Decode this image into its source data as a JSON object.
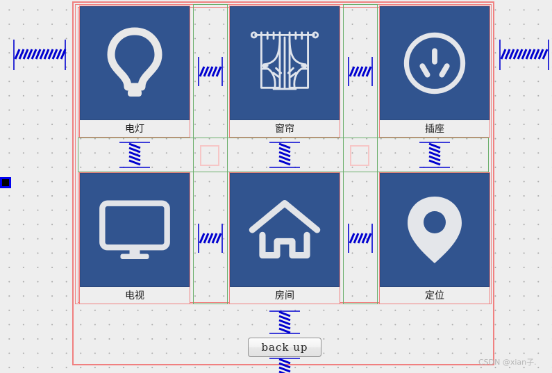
{
  "editor": {
    "name": "qt-designer-form-canvas",
    "background_color": "#eeeeee",
    "grid_dot_color": "#a8a8a8",
    "layout_border_color": "#f08080",
    "grid_layout_border_color": "#6aae6a",
    "empty_cell_color": "#f6c6c6",
    "spring_color": "#0000d0",
    "tile_color": "#31548f",
    "icon_color": "#e8e8e8"
  },
  "tiles": [
    {
      "id": "light",
      "label": "电灯",
      "icon": "lightbulb-icon"
    },
    {
      "id": "curtain",
      "label": "窗帘",
      "icon": "curtain-icon"
    },
    {
      "id": "socket",
      "label": "插座",
      "icon": "power-socket-icon"
    },
    {
      "id": "tv",
      "label": "电视",
      "icon": "television-icon"
    },
    {
      "id": "room",
      "label": "房间",
      "icon": "house-icon"
    },
    {
      "id": "locate",
      "label": "定位",
      "icon": "location-pin-icon"
    }
  ],
  "springs": [
    {
      "id": "left-outer",
      "orientation": "horizontal"
    },
    {
      "id": "right-outer",
      "orientation": "horizontal"
    },
    {
      "id": "top-gap-1",
      "orientation": "horizontal"
    },
    {
      "id": "top-gap-2",
      "orientation": "horizontal"
    },
    {
      "id": "bottom-gap-1",
      "orientation": "horizontal"
    },
    {
      "id": "bottom-gap-2",
      "orientation": "horizontal"
    },
    {
      "id": "mid-col-1",
      "orientation": "vertical"
    },
    {
      "id": "mid-col-2",
      "orientation": "vertical"
    },
    {
      "id": "mid-col-3",
      "orientation": "vertical"
    },
    {
      "id": "above-button",
      "orientation": "vertical"
    },
    {
      "id": "below-button",
      "orientation": "vertical"
    }
  ],
  "button": {
    "label": "back  up",
    "name": "back-up-button"
  },
  "selection_handle": {
    "name": "resize-handle-left",
    "color": "#0000f0"
  },
  "watermark": {
    "text": "CSDN @xian子."
  }
}
